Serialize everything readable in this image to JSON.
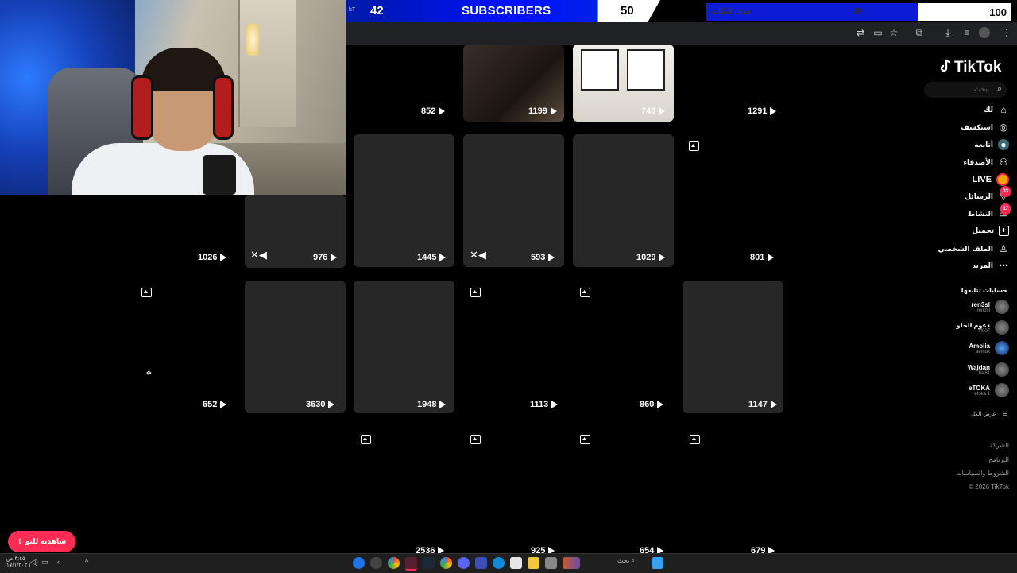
{
  "subscriber_goal": {
    "tag": "bT",
    "current": "42",
    "label": "SUBSCRIBERS",
    "goal": "50"
  },
  "like_goal": {
    "label": "هدف لايكات",
    "current": "80",
    "goal": "100",
    "progress": 0.8
  },
  "app": {
    "logo": "TikTok",
    "search_placeholder": "بحث"
  },
  "nav": [
    {
      "label": "لك",
      "icon": "home-icon"
    },
    {
      "label": "استكشف",
      "icon": "compass-icon"
    },
    {
      "label": "أتابعه",
      "icon": "following-icon"
    },
    {
      "label": "الأصدقاء",
      "icon": "friends-icon"
    },
    {
      "label": "LIVE",
      "icon": "live-icon"
    },
    {
      "label": "الرسائل",
      "icon": "messages-icon",
      "badge": "33"
    },
    {
      "label": "النشاط",
      "icon": "activity-icon",
      "badge": "17"
    },
    {
      "label": "تحميل",
      "icon": "upload-icon"
    },
    {
      "label": "الملف الشخصي",
      "icon": "profile-icon"
    },
    {
      "label": "المزيد",
      "icon": "more-icon"
    }
  ],
  "following": {
    "title": "حسابات تتابعها",
    "accounts": [
      {
        "name": "ren3sl",
        "handle": "ren3sl"
      },
      {
        "name": "دعوم الحلو",
        "handle": "fff007"
      },
      {
        "name": "Amolia",
        "handle": "aemux"
      },
      {
        "name": "Wajdan",
        "handle": "llal81"
      },
      {
        "name": "eTOKA",
        "handle": "etoka.1"
      }
    ],
    "show_all": "عرض الكل"
  },
  "footer": [
    "الشركة",
    "البرنامج",
    "الشروط والسياسات",
    "© 2026 TikTok"
  ],
  "pill": "شاهدته للتو",
  "views": {
    "r0": [
      "852",
      "1199",
      "743",
      "1291"
    ],
    "r1": [
      "1026",
      "976",
      "1445",
      "593",
      "1029",
      "801"
    ],
    "r2": [
      "652",
      "3630",
      "1948",
      "1113",
      "860",
      "1147"
    ],
    "r3": [
      "2536",
      "925",
      "654",
      "679"
    ]
  },
  "taskbar": {
    "time": "٣:٤٥ ص",
    "date": "١٧/١/٢٠٢٦",
    "search_label": "بحث"
  },
  "colors": {
    "accent": "#fe2c55",
    "sub_bar": "#0011ff",
    "background": "#000000"
  }
}
